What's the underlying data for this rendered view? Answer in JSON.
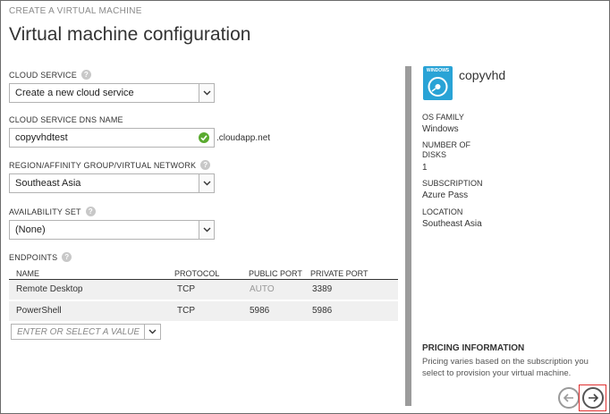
{
  "wizard": {
    "label": "CREATE A VIRTUAL MACHINE",
    "title": "Virtual machine configuration"
  },
  "cloud_service": {
    "label": "CLOUD SERVICE",
    "value": "Create a new cloud service"
  },
  "dns_name": {
    "label": "CLOUD SERVICE DNS NAME",
    "value": "copyvhdtest",
    "suffix": ".cloudapp.net"
  },
  "region": {
    "label": "REGION/AFFINITY GROUP/VIRTUAL NETWORK",
    "value": "Southeast Asia"
  },
  "availability_set": {
    "label": "AVAILABILITY SET",
    "value": "(None)"
  },
  "endpoints": {
    "label": "ENDPOINTS",
    "columns": [
      "NAME",
      "PROTOCOL",
      "PUBLIC PORT",
      "PRIVATE PORT"
    ],
    "rows": [
      {
        "name": "Remote Desktop",
        "protocol": "TCP",
        "public_port": "AUTO",
        "private_port": "3389"
      },
      {
        "name": "PowerShell",
        "protocol": "TCP",
        "public_port": "5986",
        "private_port": "5986"
      }
    ],
    "input_placeholder": "ENTER OR SELECT A VALUE"
  },
  "summary": {
    "icon_tag": "WINDOWS",
    "vm_name": "copyvhd",
    "os_family_label": "OS FAMILY",
    "os_family": "Windows",
    "disks_label_1": "NUMBER OF",
    "disks_label_2": "DISKS",
    "disks": "1",
    "subscription_label": "SUBSCRIPTION",
    "subscription": "Azure Pass",
    "location_label": "LOCATION",
    "location": "Southeast Asia"
  },
  "pricing": {
    "title": "PRICING INFORMATION",
    "text": "Pricing varies based on the subscription you select to provision your virtual machine."
  },
  "colors": {
    "accent": "#29a3d6",
    "ok": "#5aaa2f",
    "highlight": "#e03030",
    "disabled_text": "#999999"
  },
  "icons": {
    "help": "help-icon",
    "check": "checkmark-circle-icon",
    "dropdown": "chevron-down-icon",
    "back": "arrow-left-icon",
    "next": "arrow-right-icon"
  }
}
